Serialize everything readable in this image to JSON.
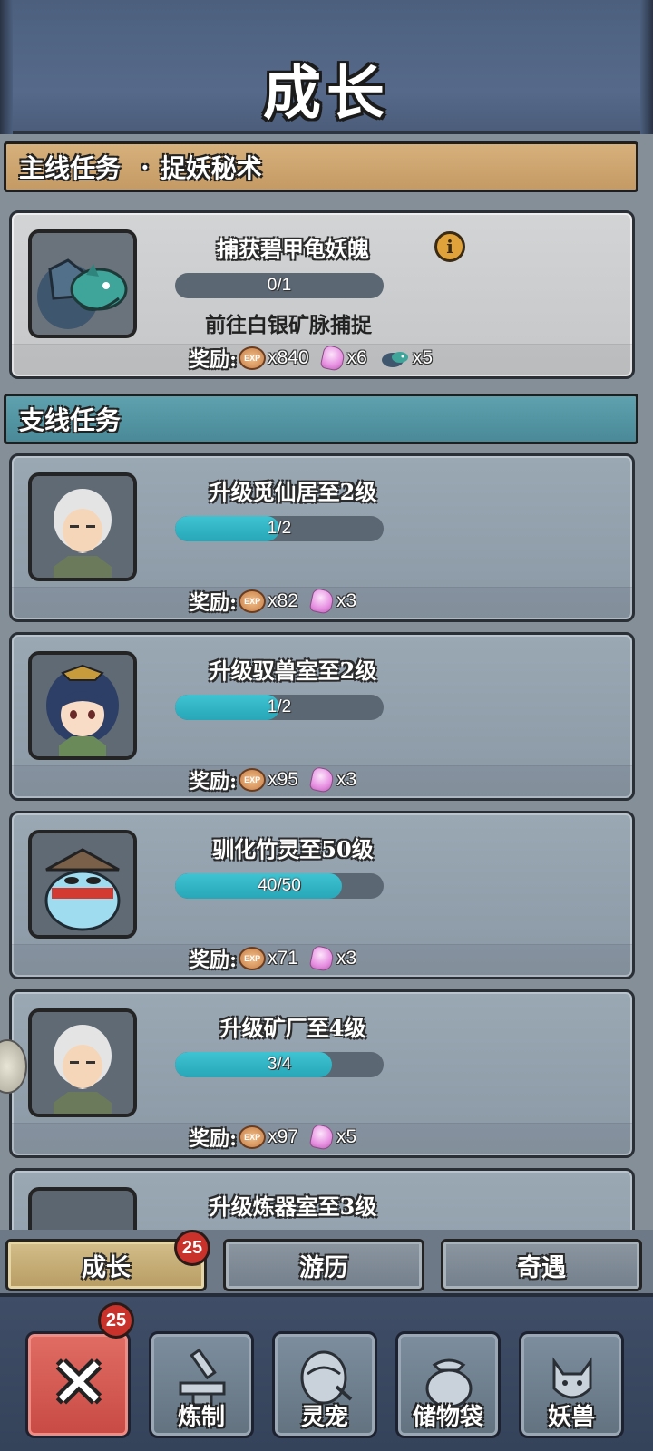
{
  "header": {
    "title": "成长"
  },
  "main_section": {
    "label": "主线任务",
    "dot": "·",
    "chapter": "捉妖秘术",
    "task": {
      "name": "捕获碧甲龟妖魄",
      "progress_text": "0/1",
      "progress": 0,
      "subtitle": "前往白银矿脉捕捉",
      "reward_label": "奖励:",
      "rewards": [
        "x840",
        "x6",
        "x5"
      ]
    }
  },
  "side_section": {
    "label": "支线任务",
    "tasks": [
      {
        "name": "升级觅仙居至2级",
        "progress_text": "1/2",
        "progress": 0.5,
        "reward_label": "奖励:",
        "rewards": [
          "x82",
          "x3"
        ]
      },
      {
        "name": "升级驭兽室至2级",
        "progress_text": "1/2",
        "progress": 0.5,
        "reward_label": "奖励:",
        "rewards": [
          "x95",
          "x3"
        ]
      },
      {
        "name": "驯化竹灵至50级",
        "progress_text": "40/50",
        "progress": 0.8,
        "reward_label": "奖励:",
        "rewards": [
          "x71",
          "x3"
        ]
      },
      {
        "name": "升级矿厂至4级",
        "progress_text": "3/4",
        "progress": 0.75,
        "reward_label": "奖励:",
        "rewards": [
          "x97",
          "x5"
        ]
      },
      {
        "name": "升级炼器室至3级"
      }
    ]
  },
  "tabs": [
    {
      "label": "成长",
      "badge": "25",
      "active": true
    },
    {
      "label": "游历"
    },
    {
      "label": "奇遇"
    }
  ],
  "nav": {
    "close_badge": "25",
    "items": [
      {
        "label": "炼制",
        "icon": "anvil-icon"
      },
      {
        "label": "灵宠",
        "icon": "pet-egg-icon"
      },
      {
        "label": "储物袋",
        "icon": "storage-bag-icon"
      },
      {
        "label": "妖兽",
        "icon": "beast-icon"
      }
    ]
  },
  "colors": {
    "progress_fill": "#2fb5c5",
    "main_banner": "#cfa571",
    "side_banner": "#569aa7",
    "badge": "#c8322a",
    "close_button": "#d55a53"
  },
  "icons": {
    "exp": "EXP",
    "gem": "pink-gem-icon",
    "turtle": "turtle-soul-icon",
    "info": "i"
  }
}
